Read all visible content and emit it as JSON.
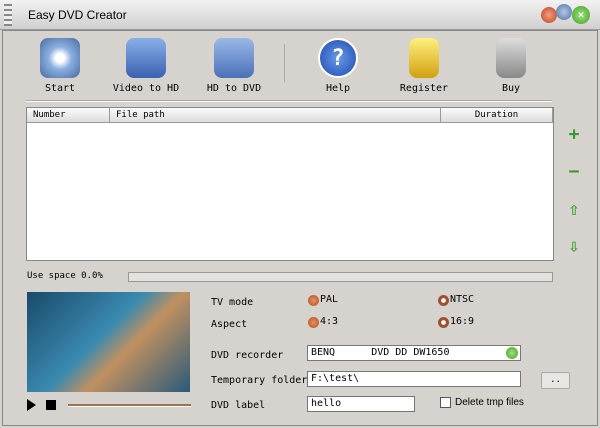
{
  "window": {
    "title": "Easy DVD Creator"
  },
  "toolbar": [
    {
      "label": "Start",
      "icon": "dvd-film-icon"
    },
    {
      "label": "Video to HD",
      "icon": "folder-film-icon"
    },
    {
      "label": "HD to DVD",
      "icon": "folder-disc-icon"
    },
    {
      "label": "Help",
      "icon": "help-icon"
    },
    {
      "label": "Register",
      "icon": "lock-icon"
    },
    {
      "label": "Buy",
      "icon": "cart-icon"
    }
  ],
  "table": {
    "columns": [
      "Number",
      "File path",
      "Duration"
    ],
    "rows": []
  },
  "side": {
    "add": "+",
    "remove": "−",
    "up": "⇧",
    "down": "⇩"
  },
  "usage": {
    "label": "Use space 0.0%",
    "percent": 0
  },
  "settings": {
    "tv_mode_label": "TV mode",
    "pal": "PAL",
    "ntsc": "NTSC",
    "tv_mode": "PAL",
    "aspect_label": "Aspect",
    "a43": "4:3",
    "a169": "16:9",
    "aspect": "4:3",
    "recorder_label": "DVD recorder",
    "recorder": "BENQ      DVD DD DW1650",
    "tmp_label": "Temporary folder",
    "tmp": "F:\\test\\",
    "browse": "..",
    "dvd_label_label": "DVD label",
    "dvd_label": "hello",
    "delete_tmp": "Delete tmp files"
  }
}
